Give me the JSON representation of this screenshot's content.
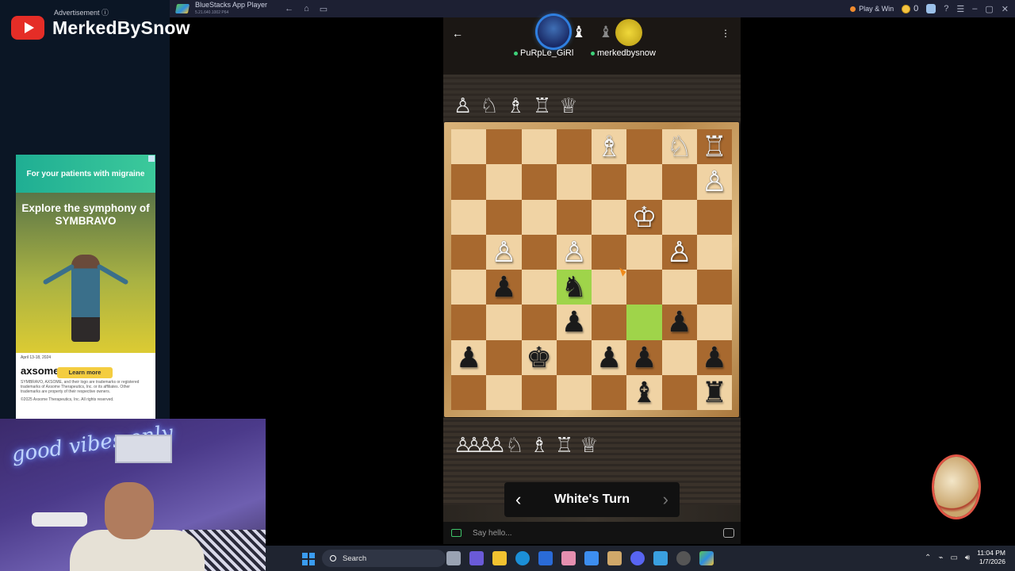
{
  "bluestacks": {
    "title": "BlueStacks App Player",
    "subtitle": "5.21.640.1002 P64",
    "play_win": "Play & Win",
    "coins": "0"
  },
  "overlay": {
    "advertisement_label": "Advertisement ⓘ",
    "channel_name": "MerkedBySnow"
  },
  "ad": {
    "top_text": "For your patients with migraine",
    "headline": "Explore the symphony of SYMBRAVO",
    "cta": "Learn more",
    "date": "April 13-18, 2024",
    "brand": "axsome",
    "fine_print": "SYMBRAVO, AXSOME, and their logo are trademarks or registered trademarks of Axsome Therapeutics, Inc. or its affiliates. Other trademarks are property of their respective owners.",
    "copyright": "©2025 Axsome Therapeutics, Inc. All rights reserved."
  },
  "webcam": {
    "neon_text": "good vibes only"
  },
  "game": {
    "player_left": "PuRpLe_GiRl",
    "player_right": "merkedbysnow",
    "turn_text": "White's Turn",
    "chat_placeholder": "Say hello...",
    "captured_top": [
      "♙",
      "♘",
      "♗",
      "♖",
      "♕"
    ],
    "captured_bottom": [
      "♙♙♙♙",
      "♘",
      "♗",
      "♖",
      "♕"
    ],
    "board": [
      [
        "",
        "",
        "",
        "",
        "♗",
        "",
        "♘",
        "♖"
      ],
      [
        "",
        "",
        "",
        "",
        "",
        "",
        "",
        "♙"
      ],
      [
        "",
        "",
        "",
        "",
        "",
        "♔",
        "",
        ""
      ],
      [
        "",
        "♙",
        "",
        "♙",
        "",
        "",
        "♙",
        ""
      ],
      [
        "",
        "♟",
        "",
        "♞",
        "",
        "",
        "",
        ""
      ],
      [
        "",
        "",
        "",
        "♟",
        "",
        "",
        "♟",
        ""
      ],
      [
        "♟",
        "",
        "♚",
        "",
        "♟",
        "♟",
        "",
        "♟"
      ],
      [
        "",
        "",
        "",
        "",
        "",
        "♝",
        "",
        "♜"
      ]
    ],
    "highlights": [
      [
        4,
        3
      ],
      [
        5,
        5
      ]
    ]
  },
  "taskbar": {
    "search": "Search",
    "time": "11:04 PM",
    "date": "1/7/2026"
  }
}
